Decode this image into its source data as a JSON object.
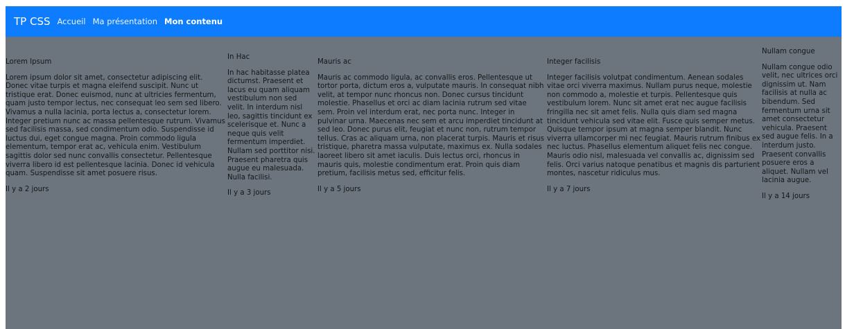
{
  "navbar": {
    "brand": "TP CSS",
    "links": [
      "Accueil",
      "Ma présentation",
      "Mon contenu"
    ]
  },
  "articles": [
    {
      "title": "Lorem Ipsum",
      "body": "Lorem ipsum dolor sit amet, consectetur adipiscing elit. Donec vitae turpis et magna eleifend suscipit. Nunc ut tristique erat. Donec euismod, nunc at ultricies fermentum, quam justo tempor lectus, nec consequat leo sem sed libero. Vivamus a nulla lacinia, porta lectus a, consectetur lorem. Integer pretium nunc ac massa pellentesque rutrum. Vivamus sed facilisis massa, sed condimentum odio. Suspendisse id luctus dui, eget congue magna. Proin commodo ligula elementum, tempor erat ac, vehicula enim. Vestibulum sagittis dolor sed nunc convallis consectetur. Pellentesque viverra libero id est pellentesque lacinia. Donec id vehicula quam. Suspendisse sit amet posuere risus.",
      "ago": "Il y a 2 jours"
    },
    {
      "title": "In Hac",
      "body": "In hac habitasse platea dictumst. Praesent et lacus eu quam aliquam vestibulum non sed velit. In interdum nisl leo, sagittis tincidunt ex scelerisque et. Nunc a neque quis velit fermentum imperdiet. Nullam sed porttitor nisi. Praesent pharetra quis augue eu malesuada. Nulla facilisi.",
      "ago": "Il y a 3 jours"
    },
    {
      "title": "Mauris ac",
      "body": "Mauris ac commodo ligula, ac convallis eros. Pellentesque ut tortor porta, dictum eros a, vulputate mauris. In consequat nibh velit, at tempor nunc rhoncus non. Donec cursus tincidunt molestie. Phasellus et orci ac diam lacinia rutrum sed vitae sem. Proin vel interdum erat, nec porta nunc. Integer in pulvinar urna. Maecenas nec sem et arcu imperdiet tincidunt at sed leo. Donec purus elit, feugiat et nunc non, rutrum tempor tellus. Cras ac aliquam urna, non placerat turpis. Mauris et risus tristique, pharetra massa vulputate, maximus ex. Nulla sodales laoreet libero sit amet iaculis. Duis lectus orci, rhoncus in mauris quis, molestie condimentum erat. Proin quis diam pretium, facilisis metus sed, efficitur felis.",
      "ago": "Il y a 5 jours"
    },
    {
      "title": "Integer facilisis",
      "body": "Integer facilisis volutpat condimentum. Aenean sodales vitae orci viverra maximus. Nullam purus neque, molestie non commodo a, molestie et turpis. Pellentesque quis vestibulum lorem. Nunc sit amet erat nec augue facilisis fringilla nec sit amet felis. Nulla quis diam sed magna tincidunt vehicula sed vitae elit. Fusce quis semper metus. Quisque tempor ipsum at magna semper blandit. Nunc viverra ullamcorper mi nec feugiat. Mauris rutrum finibus ex nec luctus. Phasellus elementum aliquet felis nec congue. Mauris odio nisl, malesuada vel convallis ac, dignissim sed felis. Orci varius natoque penatibus et magnis dis parturient montes, nascetur ridiculus mus.",
      "ago": "Il y a 7 jours"
    },
    {
      "title": "Nullam congue",
      "body": "Nullam congue odio velit, nec ultrices orci dignissim ut. Nam facilisis at nulla ac bibendum. Sed fermentum urna sit amet consectetur vehicula. Praesent sed augue felis. In a interdum justo. Praesent convallis posuere eros a aliquet. Nullam vel lacinia augue.",
      "ago": "Il y a 14 jours"
    }
  ],
  "colors": {
    "navbar": "#0d7cff",
    "background": "#6c757d",
    "text": "#14171a"
  }
}
